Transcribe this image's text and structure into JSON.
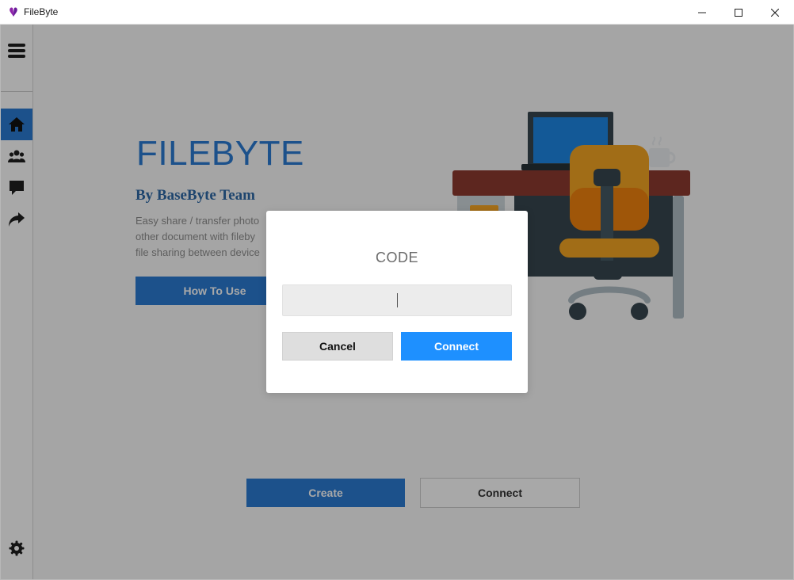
{
  "window": {
    "title": "FileByte",
    "logo_icon": "butterfly-logo-icon",
    "controls": [
      "minimize-icon",
      "maximize-icon",
      "close-icon"
    ]
  },
  "sidebar": {
    "menu_icon": "hamburger-menu-icon",
    "items": [
      {
        "icon": "home-icon",
        "active": true
      },
      {
        "icon": "users-icon",
        "active": false
      },
      {
        "icon": "chat-icon",
        "active": false
      },
      {
        "icon": "share-icon",
        "active": false
      }
    ],
    "settings_icon": "gear-icon"
  },
  "hero": {
    "title": "FILEBYTE",
    "subtitle": "By BaseByte Team",
    "description_lines": [
      "Easy share / transfer photo",
      "other document with fileby",
      "file sharing between device"
    ],
    "how_to_label": "How To Use"
  },
  "actions": {
    "create_label": "Create",
    "connect_label": "Connect"
  },
  "dialog": {
    "title": "CODE",
    "input_value": "",
    "cancel_label": "Cancel",
    "connect_label": "Connect"
  },
  "colors": {
    "accent": "#2b7bd4",
    "dialog_connect": "#1e90ff",
    "logo": "#7b1fa2"
  }
}
